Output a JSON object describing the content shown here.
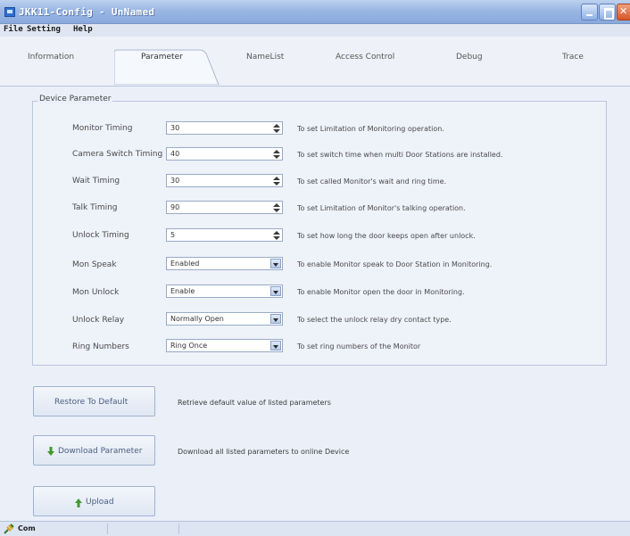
{
  "window": {
    "title": "JKK11-Config - UnNamed",
    "colors": {
      "titlebar": "#9ab7e4",
      "close_button": "#d4572b",
      "panel": "#eaeff8",
      "border": "#b9c6dc"
    }
  },
  "menu": {
    "items": [
      "File",
      "Setting",
      "Help"
    ]
  },
  "tabs": {
    "items": [
      "Information",
      "Parameter",
      "NameList",
      "Access Control",
      "Debug",
      "Trace"
    ],
    "active": "Parameter"
  },
  "group": {
    "title": "Device Parameter"
  },
  "params": [
    {
      "label": "Monitor Timing",
      "value": "30",
      "control": "spinner",
      "desc": "To set Limitation of Monitoring operation."
    },
    {
      "label": "Camera Switch Timing",
      "value": "40",
      "control": "spinner",
      "desc": "To set switch time when multi Door Stations are installed."
    },
    {
      "label": "Wait Timing",
      "value": "30",
      "control": "spinner",
      "desc": "To set called Monitor's wait and ring time."
    },
    {
      "label": "Talk Timing",
      "value": "90",
      "control": "spinner",
      "desc": "To set Limitation of Monitor's talking operation."
    },
    {
      "label": "Unlock Timing",
      "value": "5",
      "control": "spinner",
      "desc": "To set how long the door keeps open after unlock."
    },
    {
      "label": "Mon Speak",
      "value": "Enabled",
      "control": "dropdown",
      "desc": "To enable Monitor speak to Door Station in Monitoring."
    },
    {
      "label": "Mon Unlock",
      "value": "Enable",
      "control": "dropdown",
      "desc": "To enable Monitor open the door in Monitoring."
    },
    {
      "label": "Unlock Relay",
      "value": "Normally Open",
      "control": "dropdown",
      "desc": "To select the unlock relay dry contact type."
    },
    {
      "label": "Ring Numbers",
      "value": "Ring Once",
      "control": "dropdown",
      "desc": "To set ring numbers of the Monitor"
    }
  ],
  "actions": {
    "restore": {
      "label": "Restore To Default",
      "desc": "Retrieve default value of listed parameters"
    },
    "download": {
      "label": "Download Parameter",
      "desc": "Download all listed parameters to online Device",
      "icon": "green-down-arrow-icon"
    },
    "upload": {
      "label": "Upload",
      "icon": "green-up-arrow-icon"
    }
  },
  "status": {
    "text": "Com"
  }
}
